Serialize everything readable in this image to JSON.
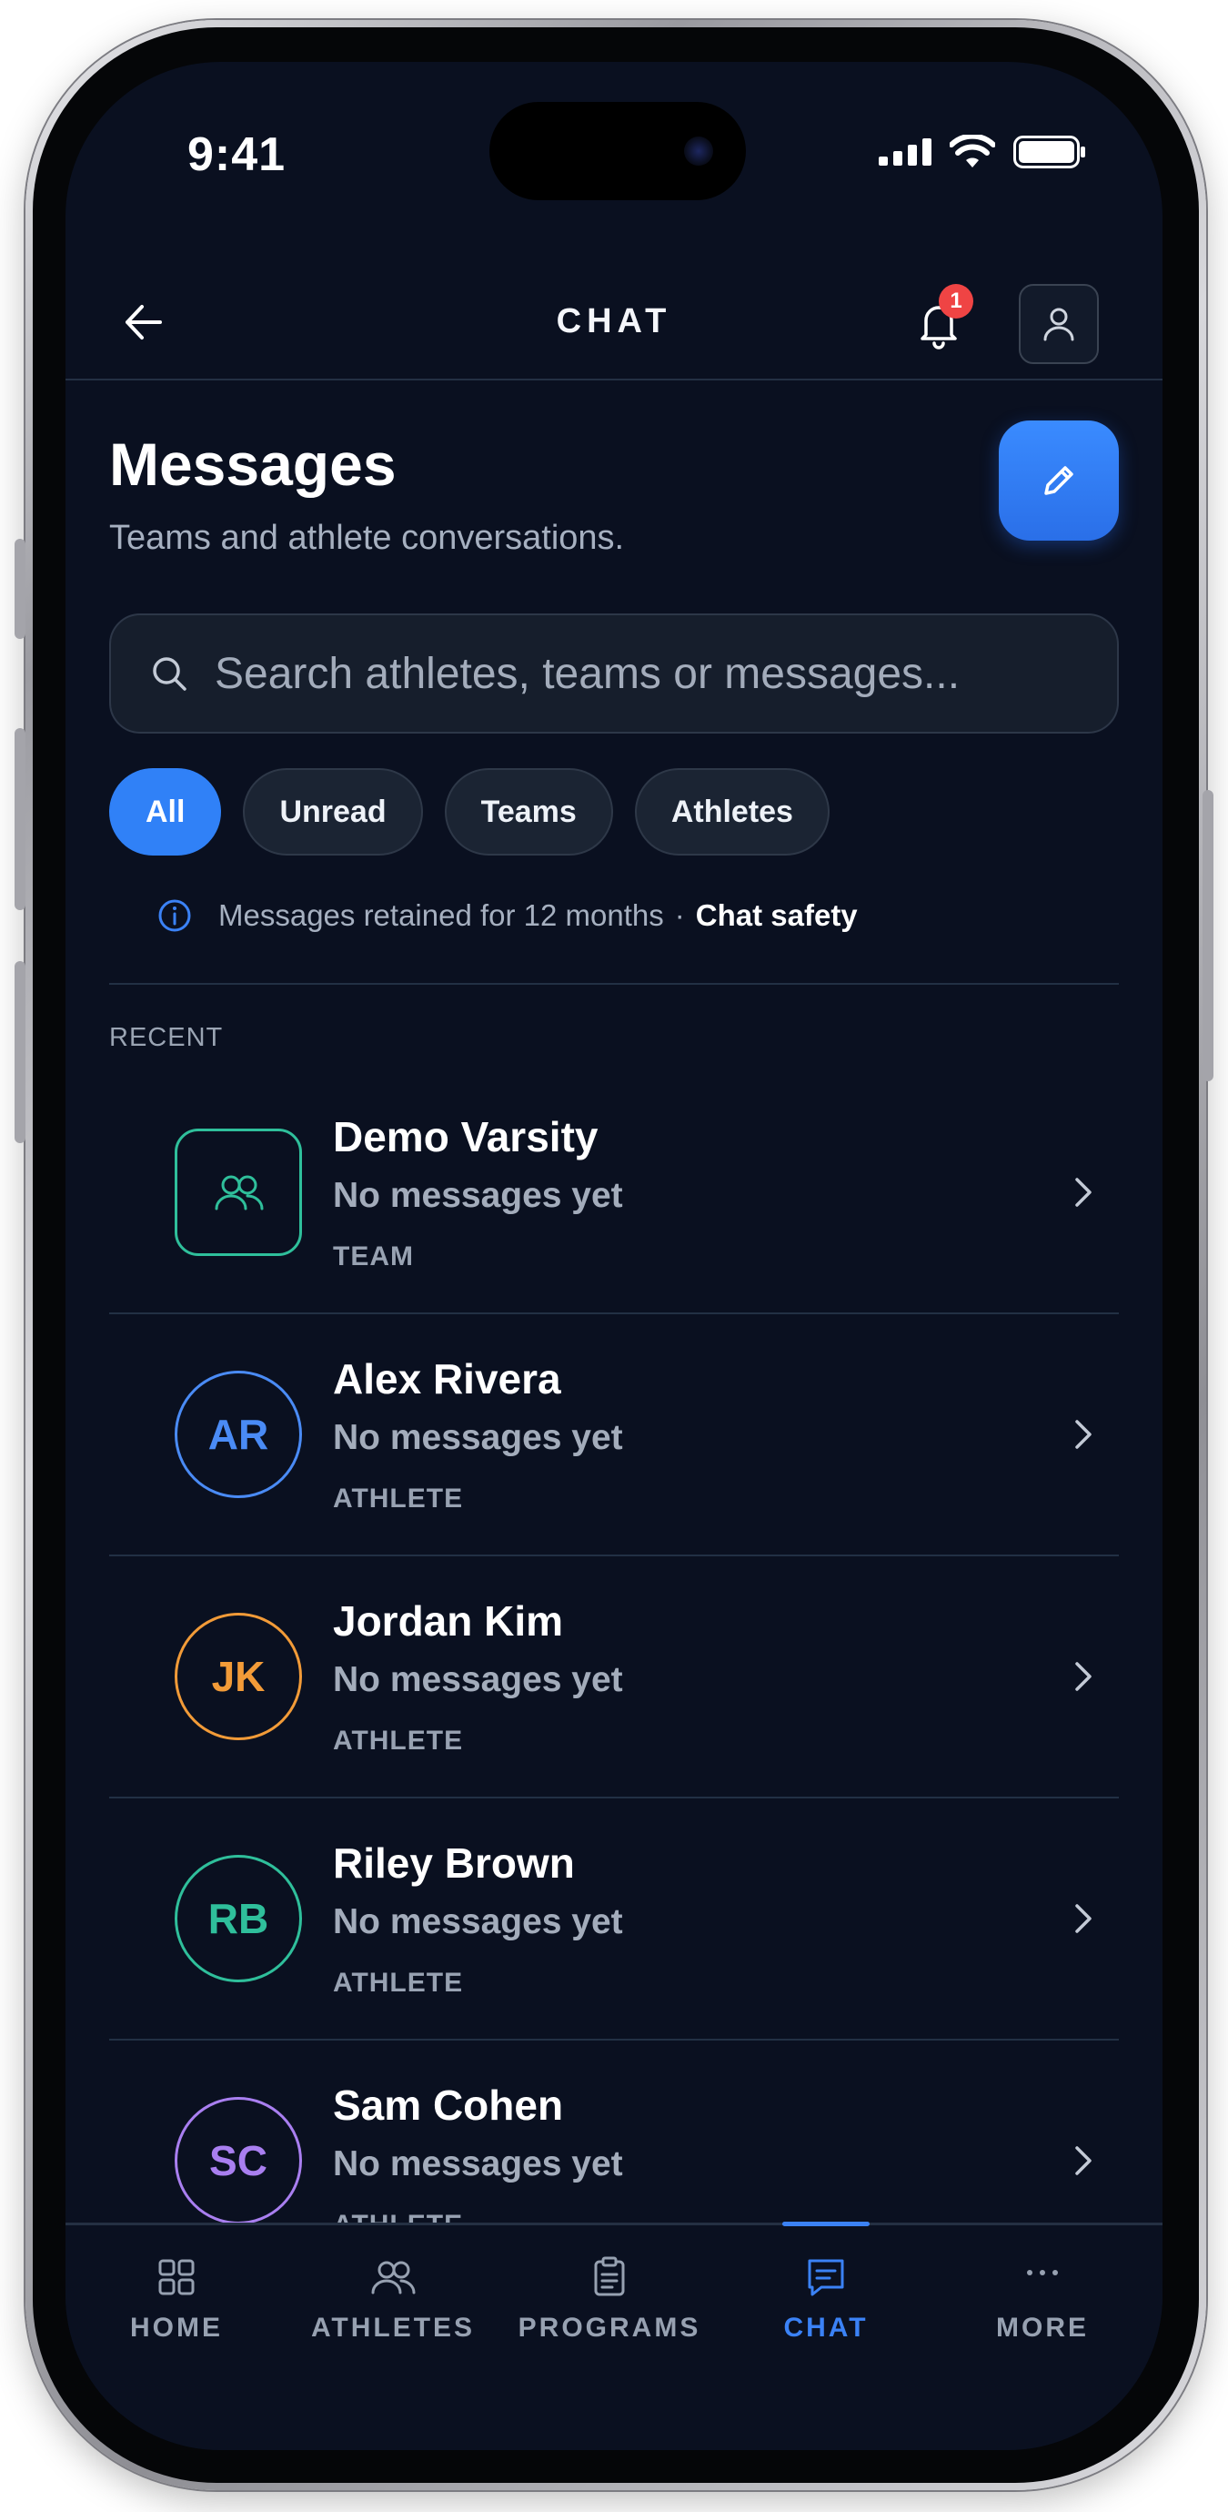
{
  "status_bar": {
    "time": "9:41"
  },
  "header": {
    "title": "CHAT",
    "notification_count": "1"
  },
  "page": {
    "title": "Messages",
    "subtitle": "Teams and athlete conversations."
  },
  "search": {
    "placeholder": "Search athletes, teams or messages..."
  },
  "filters": [
    {
      "label": "All",
      "active": true
    },
    {
      "label": "Unread",
      "active": false
    },
    {
      "label": "Teams",
      "active": false
    },
    {
      "label": "Athletes",
      "active": false
    }
  ],
  "notice": {
    "text": "Messages retained for 12 months",
    "separator": "·",
    "link": "Chat safety"
  },
  "section_label": "RECENT",
  "conversations": [
    {
      "name": "Demo Varsity",
      "preview": "No messages yet",
      "type": "TEAM",
      "avatar_icon": "team-icon",
      "color": "#2fbf9b"
    },
    {
      "name": "Alex Rivera",
      "preview": "No messages yet",
      "type": "ATHLETE",
      "initials": "AR",
      "color": "#4a8bf5"
    },
    {
      "name": "Jordan Kim",
      "preview": "No messages yet",
      "type": "ATHLETE",
      "initials": "JK",
      "color": "#f29b38"
    },
    {
      "name": "Riley Brown",
      "preview": "No messages yet",
      "type": "ATHLETE",
      "initials": "RB",
      "color": "#2fbf9b"
    },
    {
      "name": "Sam Cohen",
      "preview": "No messages yet",
      "type": "ATHLETE",
      "initials": "SC",
      "color": "#a97ff0"
    }
  ],
  "bottom_nav": [
    {
      "label": "HOME",
      "icon": "grid-icon",
      "active": false
    },
    {
      "label": "ATHLETES",
      "icon": "users-icon",
      "active": false
    },
    {
      "label": "PROGRAMS",
      "icon": "clipboard-icon",
      "active": false
    },
    {
      "label": "CHAT",
      "icon": "chat-icon",
      "active": true
    },
    {
      "label": "MORE",
      "icon": "more-icon",
      "active": false
    }
  ],
  "colors": {
    "background": "#0a1020",
    "accent": "#3081f7",
    "badge": "#ef4444"
  }
}
